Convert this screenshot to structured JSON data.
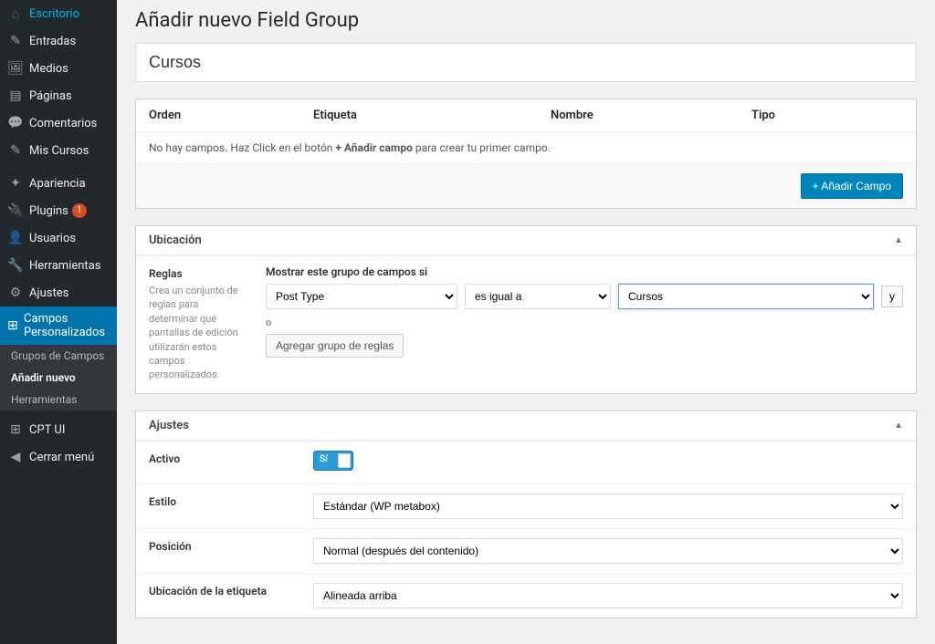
{
  "sidebar": {
    "items": [
      {
        "label": "Escritorio",
        "icon": "⌂"
      },
      {
        "label": "Entradas",
        "icon": "✎"
      },
      {
        "label": "Medios",
        "icon": "🖼"
      },
      {
        "label": "Páginas",
        "icon": "▤"
      },
      {
        "label": "Comentarios",
        "icon": "💬"
      },
      {
        "label": "Mis Cursos",
        "icon": "✎"
      },
      {
        "label": "Apariencia",
        "icon": "✦"
      },
      {
        "label": "Plugins",
        "icon": "🔌",
        "badge": "1"
      },
      {
        "label": "Usuarios",
        "icon": "👤"
      },
      {
        "label": "Herramientas",
        "icon": "🔧"
      },
      {
        "label": "Ajustes",
        "icon": "⚙"
      },
      {
        "label": "Campos Personalizados",
        "icon": "⊞",
        "active": true
      },
      {
        "label": "CPT UI",
        "icon": "⊞"
      },
      {
        "label": "Cerrar menú",
        "icon": "◀"
      }
    ],
    "submenu": [
      {
        "label": "Grupos de Campos"
      },
      {
        "label": "Añadir nuevo",
        "current": true
      },
      {
        "label": "Herramientas"
      }
    ]
  },
  "page": {
    "title": "Añadir nuevo Field Group",
    "group_name": "Cursos"
  },
  "fields_table": {
    "headers": {
      "order": "Orden",
      "label": "Etiqueta",
      "name": "Nombre",
      "type": "Tipo"
    },
    "empty_prefix": "No hay campos. Haz Click en el botón ",
    "empty_bold": "+ Añadir campo",
    "empty_suffix": " para crear tu primer campo.",
    "add_button": "+ Añadir Campo"
  },
  "location": {
    "section_title": "Ubicación",
    "rules_label": "Reglas",
    "rules_desc": "Crea un conjunto de reglas para determinar qué pantallas de edición utilizarán estos campos personalizados",
    "show_label": "Mostrar este grupo de campos si",
    "param": "Post Type",
    "operator": "es igual a",
    "value": "Cursos",
    "and_label": "y",
    "or_label": "o",
    "add_group": "Agregar grupo de reglas"
  },
  "settings": {
    "section_title": "Ajustes",
    "active_label": "Activo",
    "active_value": "Sí",
    "style_label": "Estilo",
    "style_value": "Estándar (WP metabox)",
    "position_label": "Posición",
    "position_value": "Normal (después del contenido)",
    "label_placement_label": "Ubicación de la etiqueta",
    "label_placement_value": "Alineada arriba"
  }
}
